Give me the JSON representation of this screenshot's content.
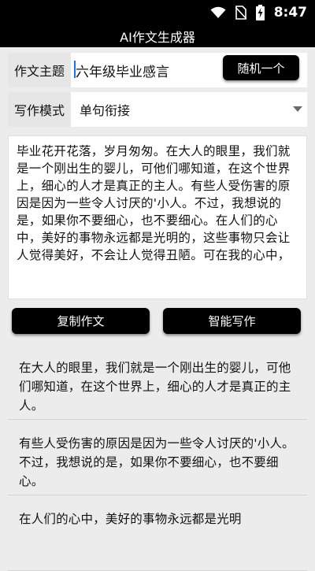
{
  "status_bar": {
    "time": "8:47",
    "icons": [
      "wifi-icon",
      "no-sim-icon",
      "battery-charging-icon"
    ]
  },
  "app": {
    "title": "AI作文生成器"
  },
  "topic": {
    "label": "作文主题",
    "value": "六年级毕业感言",
    "random_button": "随机一个"
  },
  "mode": {
    "label": "写作模式",
    "selected": "单句衔接"
  },
  "essay": {
    "text": "毕业花开花落，岁月匆匆。在大人的眼里，我们就是一个刚出生的婴儿，可他们哪知道，在这个世界上，细心的人才是真正的主人。有些人受伤害的原因是因为一些令人讨厌的'小人。不过，我想说的是，如果你不要细心，也不要细心。在人们的心中，美好的事物永远都是光明的，这些事物只会让人觉得美好，不会让人觉得丑陋。可在我的心中，"
  },
  "actions": {
    "copy": "复制作文",
    "write": "智能写作"
  },
  "sentences": [
    "在大人的眼里，我们就是一个刚出生的婴儿，可他们哪知道，在这个世界上，细心的人才是真正的主人。",
    "有些人受伤害的原因是因为一些令人讨厌的'小人。不过，我想说的是，如果你不要细心，也不要细心。",
    "在人们的心中，美好的事物永远都是光明"
  ],
  "colors": {
    "bar": "#000000",
    "background": "#ececec",
    "label_bg": "#e6e6e6",
    "caret": "#1a73e8"
  }
}
